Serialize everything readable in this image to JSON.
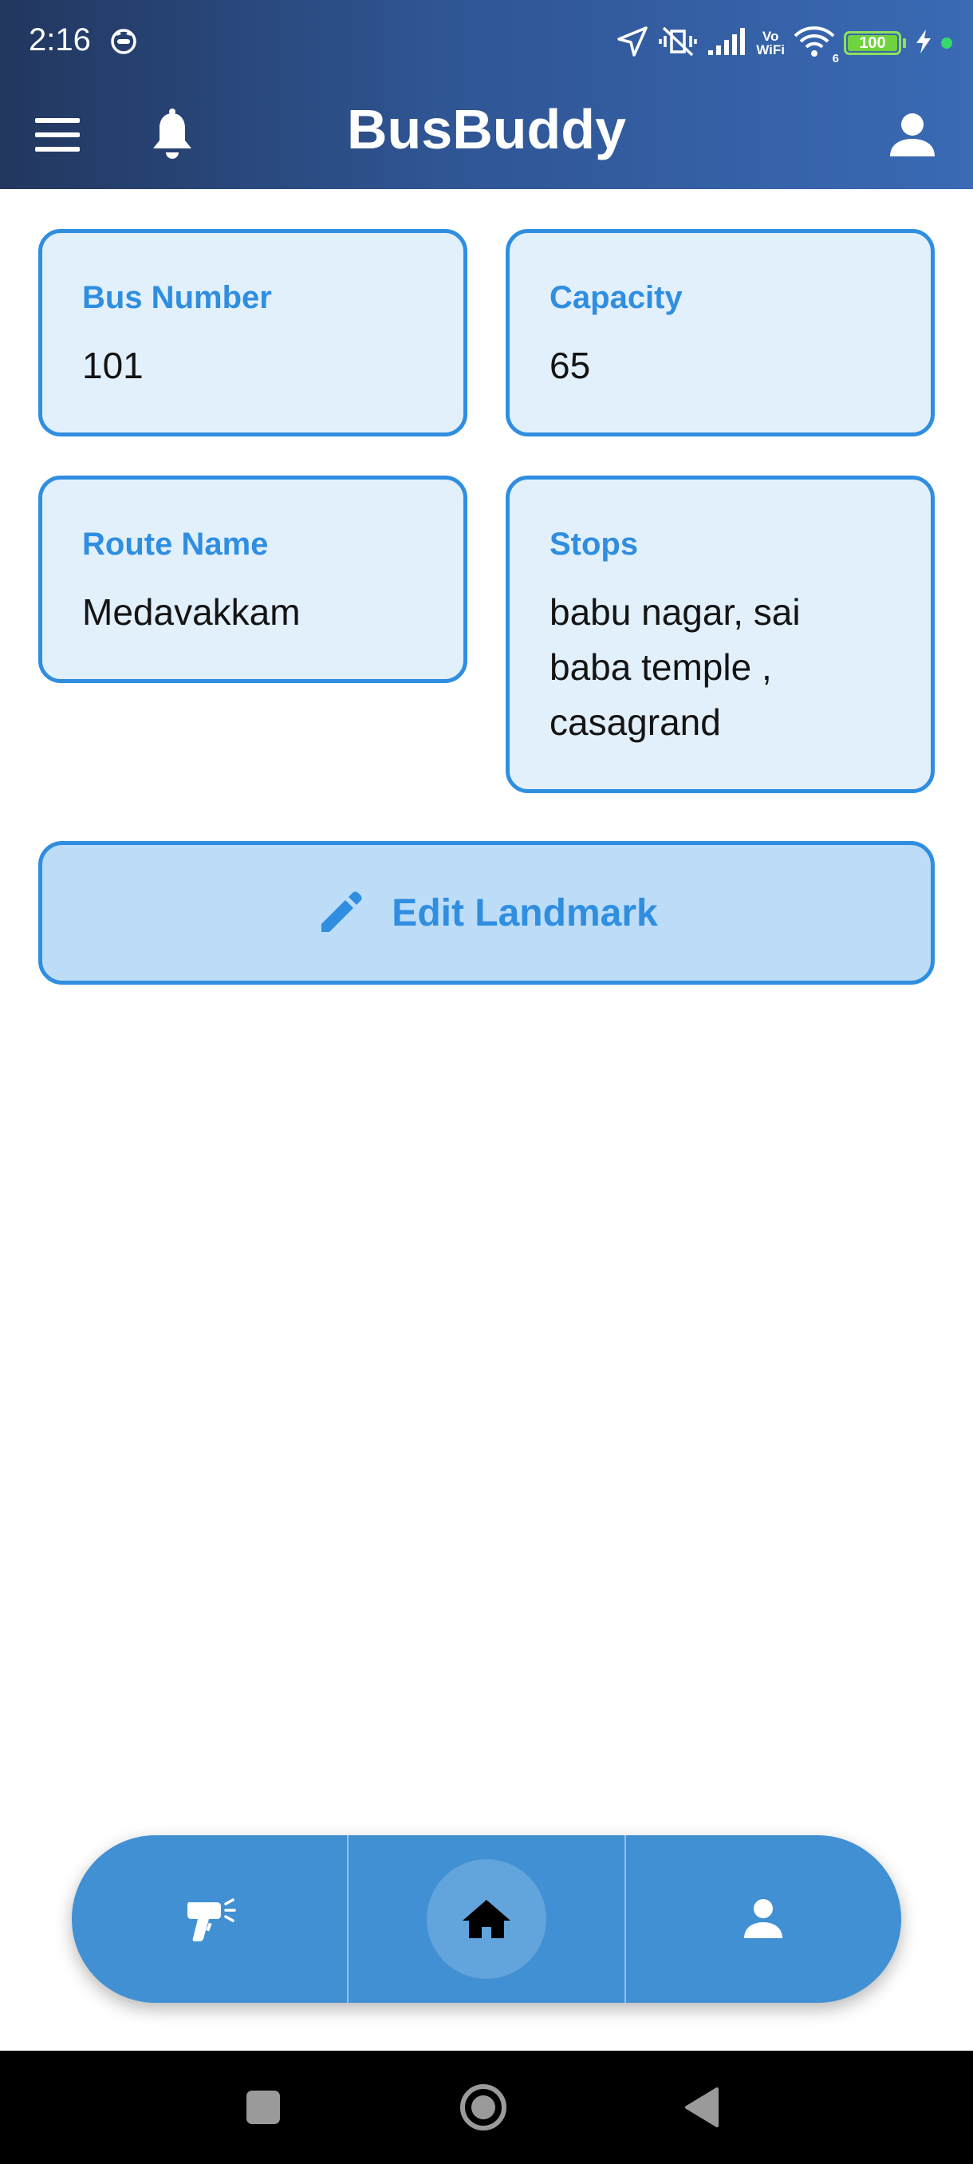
{
  "status_bar": {
    "time": "2:16",
    "battery_level": "100",
    "network_label_top": "Vo",
    "network_label_bottom": "WiFi",
    "wifi_sub": "6"
  },
  "app_bar": {
    "title": "BusBuddy"
  },
  "cards": {
    "bus_number": {
      "label": "Bus Number",
      "value": "101"
    },
    "capacity": {
      "label": "Capacity",
      "value": "65"
    },
    "route_name": {
      "label": "Route Name",
      "value": "Medavakkam"
    },
    "stops": {
      "label": "Stops",
      "value": "babu nagar, sai baba temple , casagrand"
    }
  },
  "edit_button": {
    "label": "Edit Landmark"
  },
  "bottom_nav": {
    "items": [
      "scanner-icon",
      "home-icon",
      "person-icon"
    ],
    "active_index": 1
  },
  "colors": {
    "accent": "#2f8ee0",
    "card_bg": "#e2f0fc",
    "nav_bg": "#4190d3",
    "header_dark": "#22375f",
    "header_light": "#3a6ab5"
  }
}
